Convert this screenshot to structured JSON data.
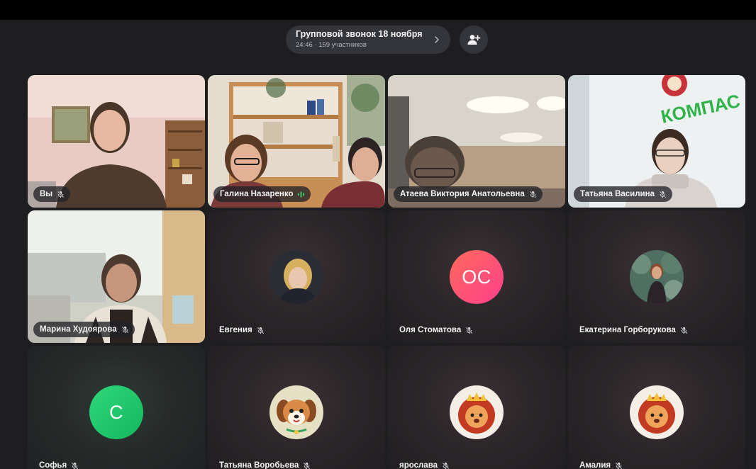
{
  "call": {
    "title": "Групповой звонок 18 ноября",
    "subtitle": "24:46 · 159 участников"
  },
  "icons": {
    "title_chevron": "chevron-right-icon",
    "add_participant": "add-participant-icon",
    "mic_muted": "mic-muted-icon",
    "speaking": "speaking-wave-icon"
  },
  "colors": {
    "speaking_border": "#3bd16f",
    "oc_avatar": "#ff4f7b",
    "s_avatar": "#1fcb6a"
  },
  "participants": [
    {
      "name": "Вы",
      "kind": "video",
      "muted": true
    },
    {
      "name": "Галина Назаренко",
      "kind": "video",
      "speaking": true
    },
    {
      "name": "Атаева Виктория Анатольевна",
      "kind": "video",
      "muted": true
    },
    {
      "name": "Татьяна Василина",
      "kind": "video",
      "muted": true
    },
    {
      "name": "Марина Худоярова",
      "kind": "video",
      "muted": true
    },
    {
      "name": "Евгения",
      "kind": "avatar-photo",
      "muted": true
    },
    {
      "name": "Оля Стоматова",
      "kind": "avatar-initials",
      "initials": "ОС",
      "muted": true
    },
    {
      "name": "Екатерина Горборукова",
      "kind": "avatar-photo",
      "muted": true
    },
    {
      "name": "Софья",
      "kind": "avatar-initials",
      "initials": "С",
      "muted": true
    },
    {
      "name": "Татьяна Воробьева",
      "kind": "avatar-dog",
      "muted": true
    },
    {
      "name": "ярослава",
      "kind": "avatar-lion",
      "muted": true
    },
    {
      "name": "Амалия",
      "kind": "avatar-lion",
      "muted": true
    }
  ],
  "background_text": {
    "sign": "КОМПАС"
  }
}
